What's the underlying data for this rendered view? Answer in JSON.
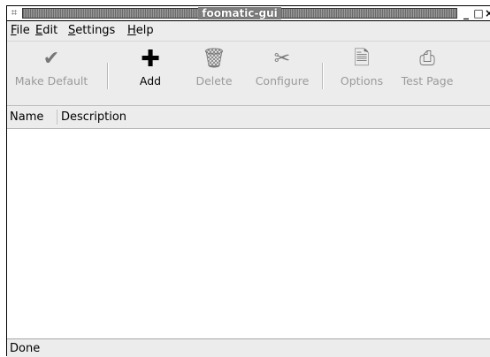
{
  "window": {
    "title": "foomatic-gui",
    "app_icon": "app-icon",
    "minimize_glyph": "_",
    "maximize_glyph": "□",
    "close_glyph": "×"
  },
  "menu": {
    "items": [
      {
        "label": "File",
        "mnemonic": "F",
        "rest": "ile"
      },
      {
        "label": "Edit",
        "mnemonic": "E",
        "rest": "dit"
      },
      {
        "label": "Settings",
        "mnemonic": "S",
        "rest": "ettings"
      },
      {
        "label": "Help",
        "mnemonic": "H",
        "rest": "elp"
      }
    ]
  },
  "toolbar": {
    "make_default": {
      "label": "Make Default",
      "icon": "checkmark-icon",
      "enabled": false
    },
    "add": {
      "label": "Add",
      "icon": "plus-icon",
      "enabled": true
    },
    "delete": {
      "label": "Delete",
      "icon": "trash-icon",
      "enabled": false
    },
    "configure": {
      "label": "Configure",
      "icon": "tools-icon",
      "enabled": false
    },
    "options": {
      "label": "Options",
      "icon": "document-icon",
      "enabled": false
    },
    "test_page": {
      "label": "Test Page",
      "icon": "printer-icon",
      "enabled": false
    }
  },
  "list": {
    "columns": [
      "Name",
      "Description"
    ],
    "rows": []
  },
  "status": {
    "text": "Done"
  }
}
